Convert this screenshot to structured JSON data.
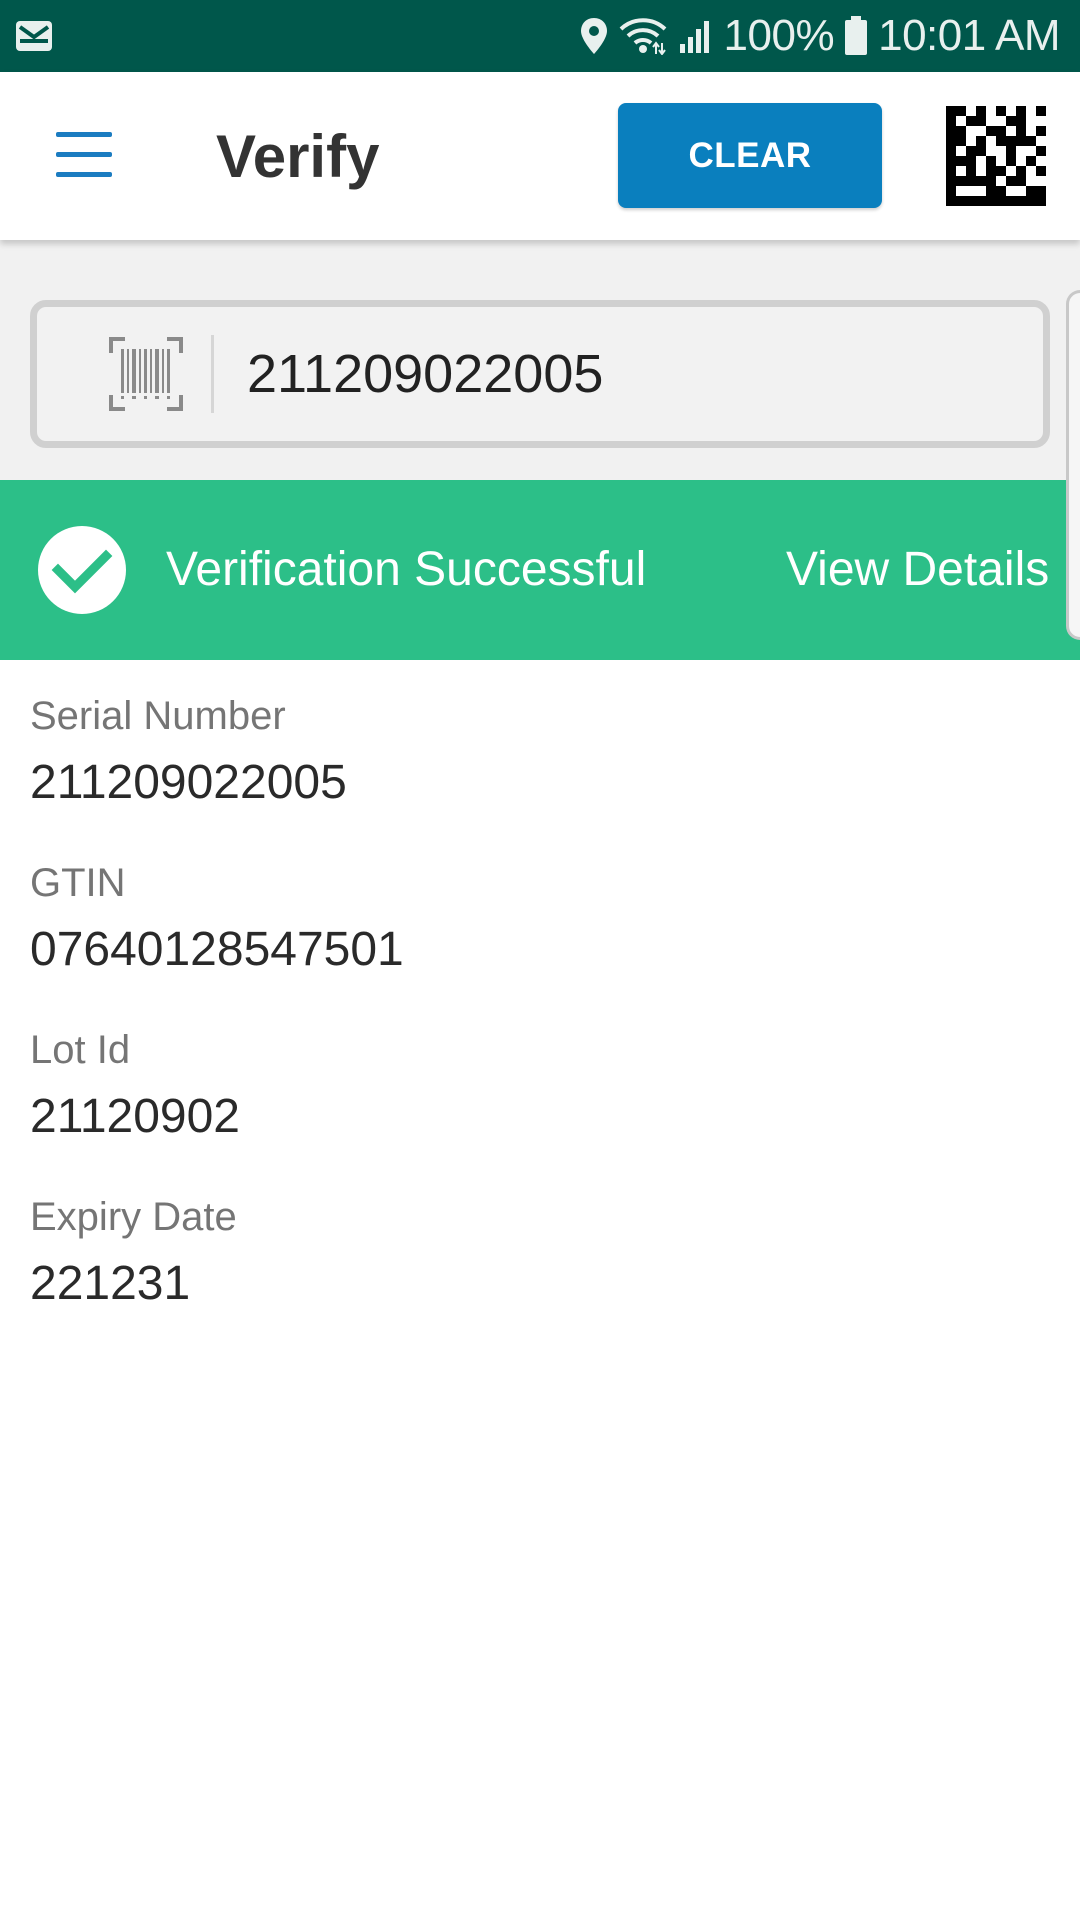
{
  "status_bar": {
    "battery": "100%",
    "time": "10:01 AM",
    "icons": [
      "email-notification-icon",
      "location-icon",
      "wifi-icon",
      "signal-icon",
      "battery-icon"
    ]
  },
  "app_bar": {
    "title": "Verify",
    "clear_label": "CLEAR",
    "menu_icon": "hamburger-menu-icon",
    "scan_icon": "datamatrix-scan-icon"
  },
  "search": {
    "value": "211209022005",
    "icon": "barcode-icon"
  },
  "banner": {
    "message": "Verification Successful",
    "link": "View Details",
    "icon": "checkmark-circle-icon"
  },
  "fields": [
    {
      "label": "Serial Number",
      "value": "211209022005"
    },
    {
      "label": "GTIN",
      "value": "07640128547501"
    },
    {
      "label": "Lot Id",
      "value": "21120902"
    },
    {
      "label": "Expiry Date",
      "value": "221231"
    }
  ],
  "colors": {
    "status_bar": "#00574b",
    "primary": "#0a7fbe",
    "success": "#2cbf88",
    "menu_icon": "#1b7cc1"
  }
}
